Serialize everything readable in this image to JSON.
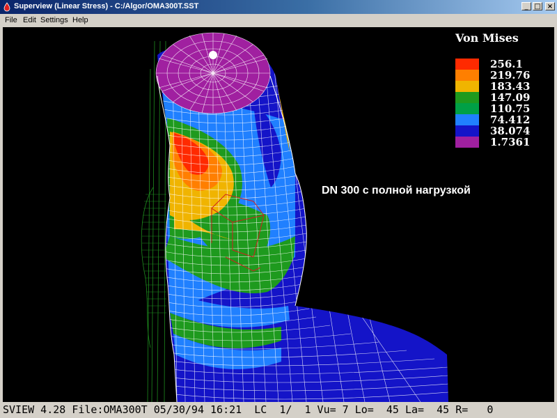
{
  "window": {
    "title": "Superview (Linear Stress) - C:/Algor/OMA300T.SST",
    "minimize_glyph": "_",
    "maximize_glyph": "□",
    "close_glyph": "×"
  },
  "menu": {
    "items": [
      "File",
      "Edit",
      "Settings",
      "Help"
    ]
  },
  "legend": {
    "title": "Von Mises",
    "entries": [
      {
        "value": "256.1",
        "color": "#ff2a00"
      },
      {
        "value": "219.76",
        "color": "#ff7f00"
      },
      {
        "value": "183.43",
        "color": "#f0b400"
      },
      {
        "value": "147.09",
        "color": "#1e9a1e"
      },
      {
        "value": "110.75",
        "color": "#00a046"
      },
      {
        "value": "74.412",
        "color": "#2080ff"
      },
      {
        "value": "38.074",
        "color": "#1414c8"
      },
      {
        "value": "1.7361",
        "color": "#a020a0"
      }
    ]
  },
  "annotation": "DN 300 с полной нагрузкой",
  "statusbar": {
    "text": "SVIEW 4.28 File:OMA300T 05/30/94 16:21  LC  1/  1 Vu= 7 Lo=  45 La=  45 R=   0"
  },
  "colors": {
    "background": "#000000",
    "mesh_lines": "#ffffff",
    "back_mesh": "#1e8c1e",
    "top_cap": "#a020a0"
  }
}
